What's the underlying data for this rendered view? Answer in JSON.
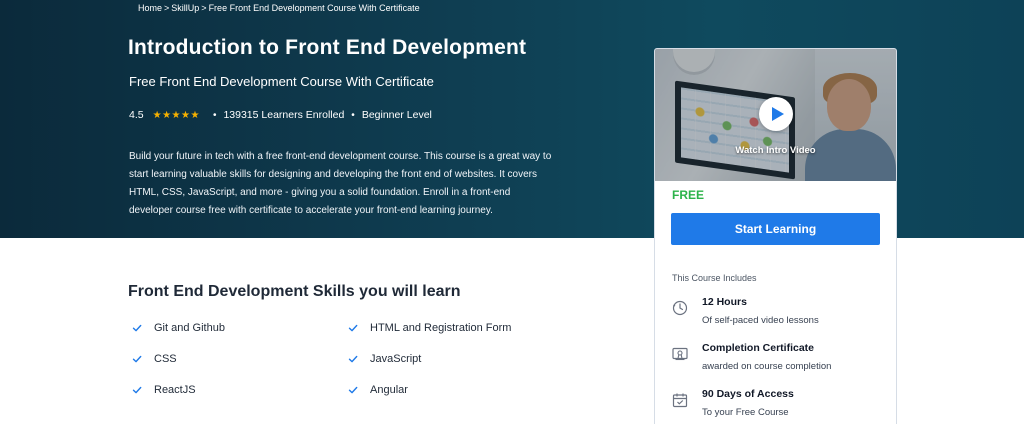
{
  "breadcrumb": {
    "home": "Home",
    "separator": ">",
    "skillup": "SkillUp",
    "separator2": ">",
    "current": "Free Front End Development Course With Certificate"
  },
  "hero": {
    "title": "Introduction to Front End Development",
    "subtitle": "Free Front End Development Course With Certificate",
    "rating": "4.5",
    "stars": "★★★★★",
    "bullet": "•",
    "learners": "139315 Learners Enrolled",
    "level": "Beginner Level",
    "description": "Build your future in tech with a free front-end development course. This course is a great way to start learning valuable skills for designing and developing the front end of websites. It covers HTML, CSS, JavaScript, and more - giving you a solid foundation. Enroll in a front-end developer course free with certificate to accelerate your front-end learning journey."
  },
  "card": {
    "video_label": "Watch Intro Video",
    "price": "FREE",
    "cta": "Start Learning",
    "includes_heading": "This Course Includes",
    "includes": [
      {
        "icon": "clock-icon",
        "title": "12 Hours",
        "sub": "Of self-paced video lessons"
      },
      {
        "icon": "certificate-icon",
        "title": "Completion Certificate",
        "sub": "awarded on course completion"
      },
      {
        "icon": "calendar-icon",
        "title": "90 Days of Access",
        "sub": "To your Free Course"
      }
    ]
  },
  "skills": {
    "heading": "Front End Development Skills you will learn",
    "items": [
      "Git and Github",
      "HTML and Registration Form",
      "CSS",
      "JavaScript",
      "ReactJS",
      "Angular"
    ]
  },
  "colors": {
    "hero_bg": "#0f3e52",
    "star": "#f6b100",
    "price_green": "#2cb34a",
    "cta_blue": "#1f7ae8",
    "check_blue": "#1f7ae8"
  }
}
